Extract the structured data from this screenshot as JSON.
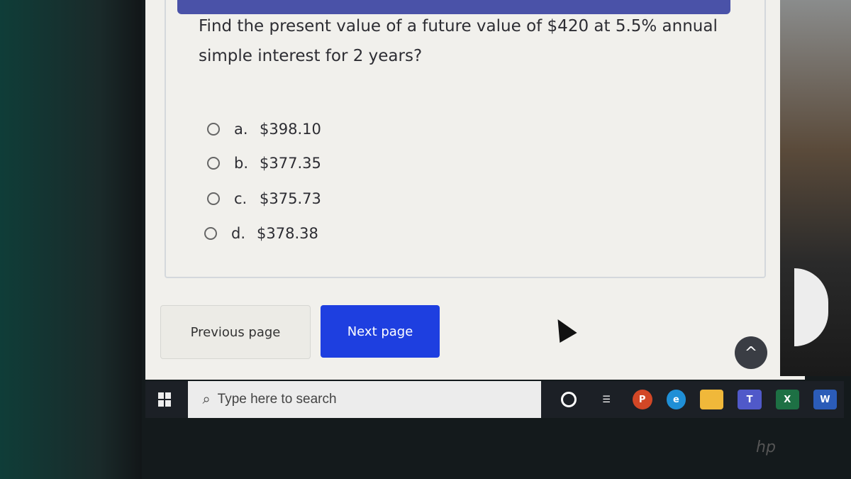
{
  "question": "Find the present value of a future value of $420 at 5.5% annual simple interest for 2 years?",
  "options": [
    {
      "letter": "a.",
      "value": "$398.10"
    },
    {
      "letter": "b.",
      "value": "$377.35"
    },
    {
      "letter": "c.",
      "value": "$375.73"
    },
    {
      "letter": "d.",
      "value": "$378.38"
    }
  ],
  "buttons": {
    "previous": "Previous page",
    "next": "Next page"
  },
  "taskbar": {
    "search_placeholder": "Type here to search",
    "apps": [
      "Cortana",
      "Task View",
      "PowerPoint",
      "Edge",
      "File Explorer",
      "Teams",
      "Excel",
      "Word"
    ]
  },
  "brand": "hp",
  "colors": {
    "next_button": "#1e3fe0",
    "taskbar": "#1c2026"
  }
}
